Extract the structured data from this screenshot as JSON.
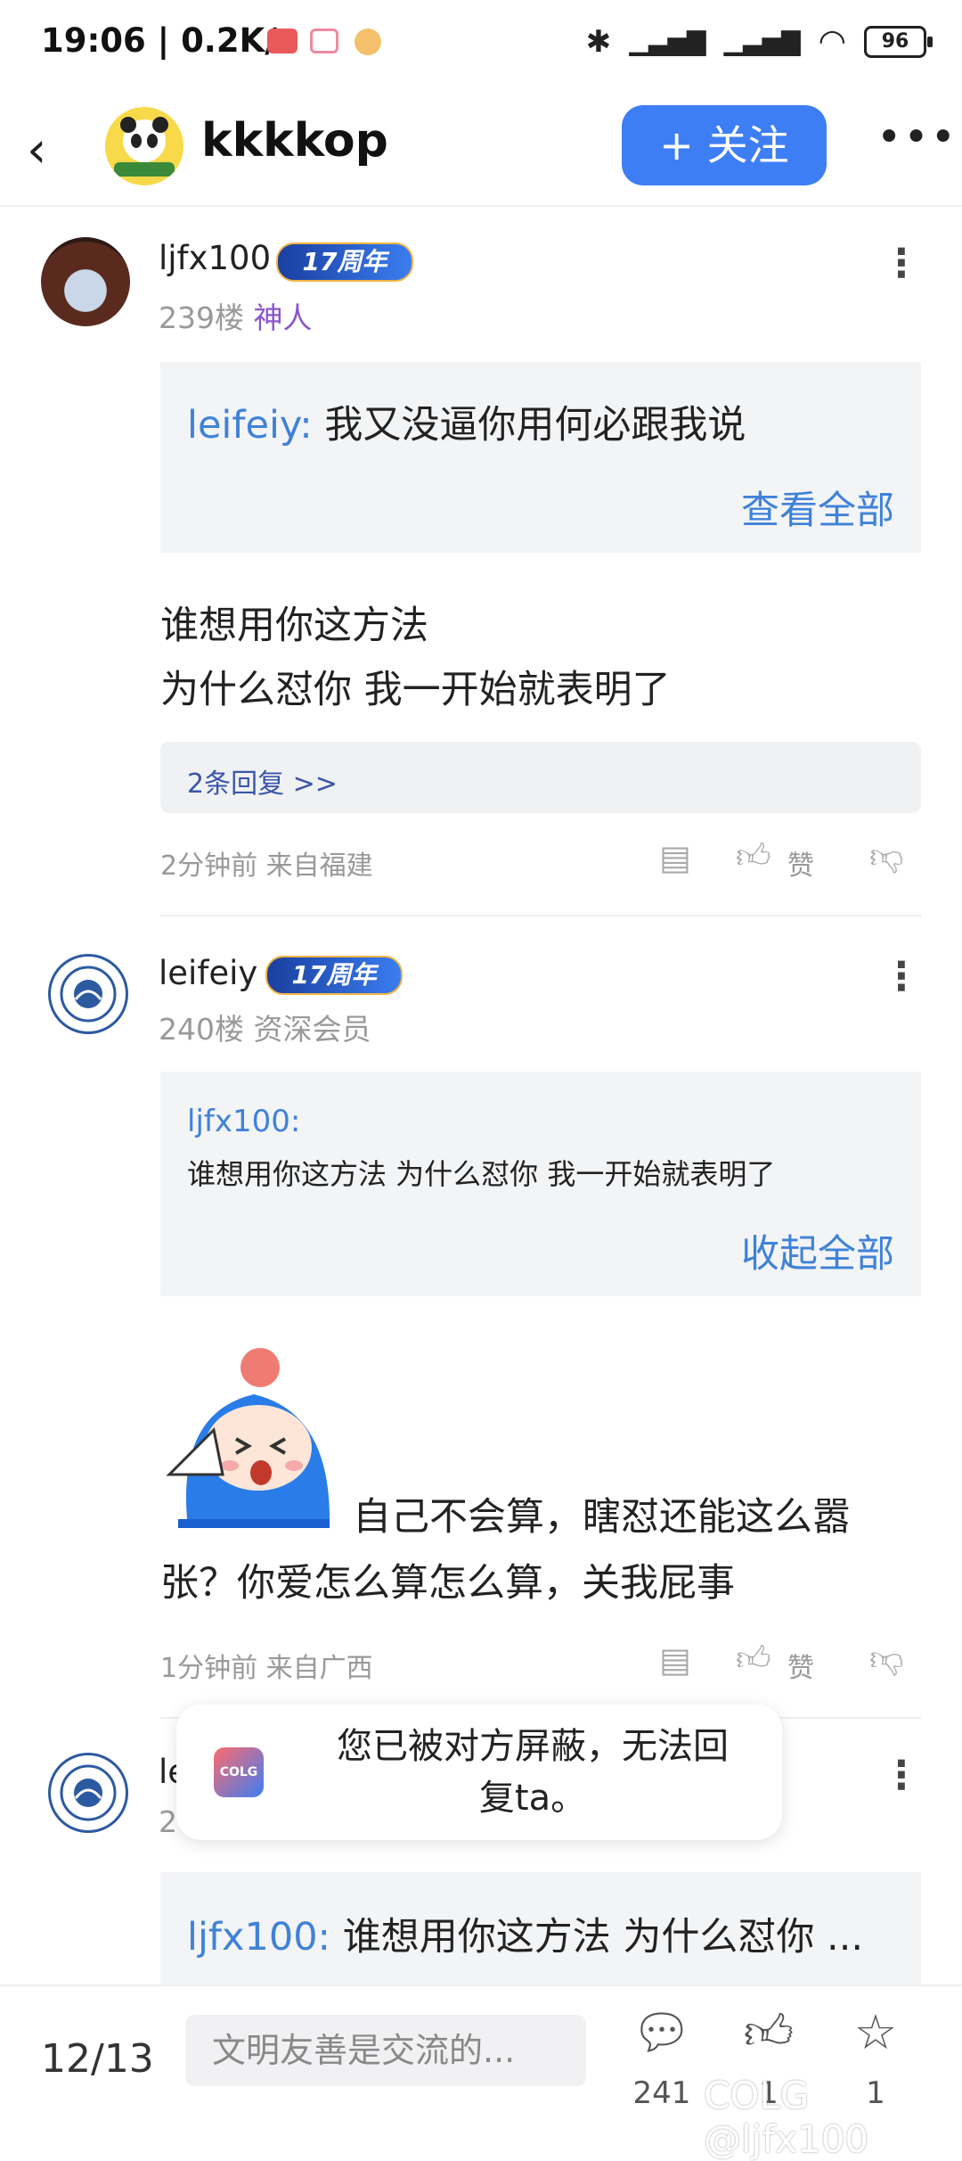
{
  "status_bar": {
    "time": "19:06",
    "speed": "0.2K/s",
    "battery": "96"
  },
  "header": {
    "forum_name": "kkkkop",
    "follow_label": "+ 关注"
  },
  "posts": [
    {
      "username": "ljfx100",
      "badge": "17周年",
      "floor": "239楼",
      "role": "神人",
      "quote_author": "leifeiy:",
      "quote_text": "我又没逼你用何必跟我说",
      "quote_action": "查看全部",
      "body_line1": "谁想用你这方法",
      "body_line2": "为什么怼你 我一开始就表明了",
      "replies": "2条回复 >>",
      "time_loc": "2分钟前 来自福建",
      "like_label": "赞"
    },
    {
      "username": "leifeiy",
      "badge": "17周年",
      "floor": "240楼",
      "role": "资深会员",
      "quote_author": "ljfx100:",
      "quote_text": "谁想用你这方法 为什么怼你 我一开始就表明了",
      "quote_action": "收起全部",
      "body_line1": "自己不会算，瞎怼还能这么嚣",
      "body_line2": "张？你爱怎么算怎么算，关我屁事",
      "time_loc": "1分钟前 来自广西",
      "like_label": "赞"
    },
    {
      "username_partial": "le",
      "floor_partial": "2",
      "quote_author": "ljfx100:",
      "quote_text": "谁想用你这方法 为什么怼你 ..."
    }
  ],
  "toast": {
    "line1": "您已被对方屏蔽，无法回",
    "line2": "复ta。",
    "logo_text": "COLG"
  },
  "bottom_bar": {
    "page": "12/13",
    "input_placeholder": "文明友善是交流的...",
    "comments": "241",
    "likes": "1",
    "favorites": "1",
    "watermark": "COLG @ljfx100"
  }
}
